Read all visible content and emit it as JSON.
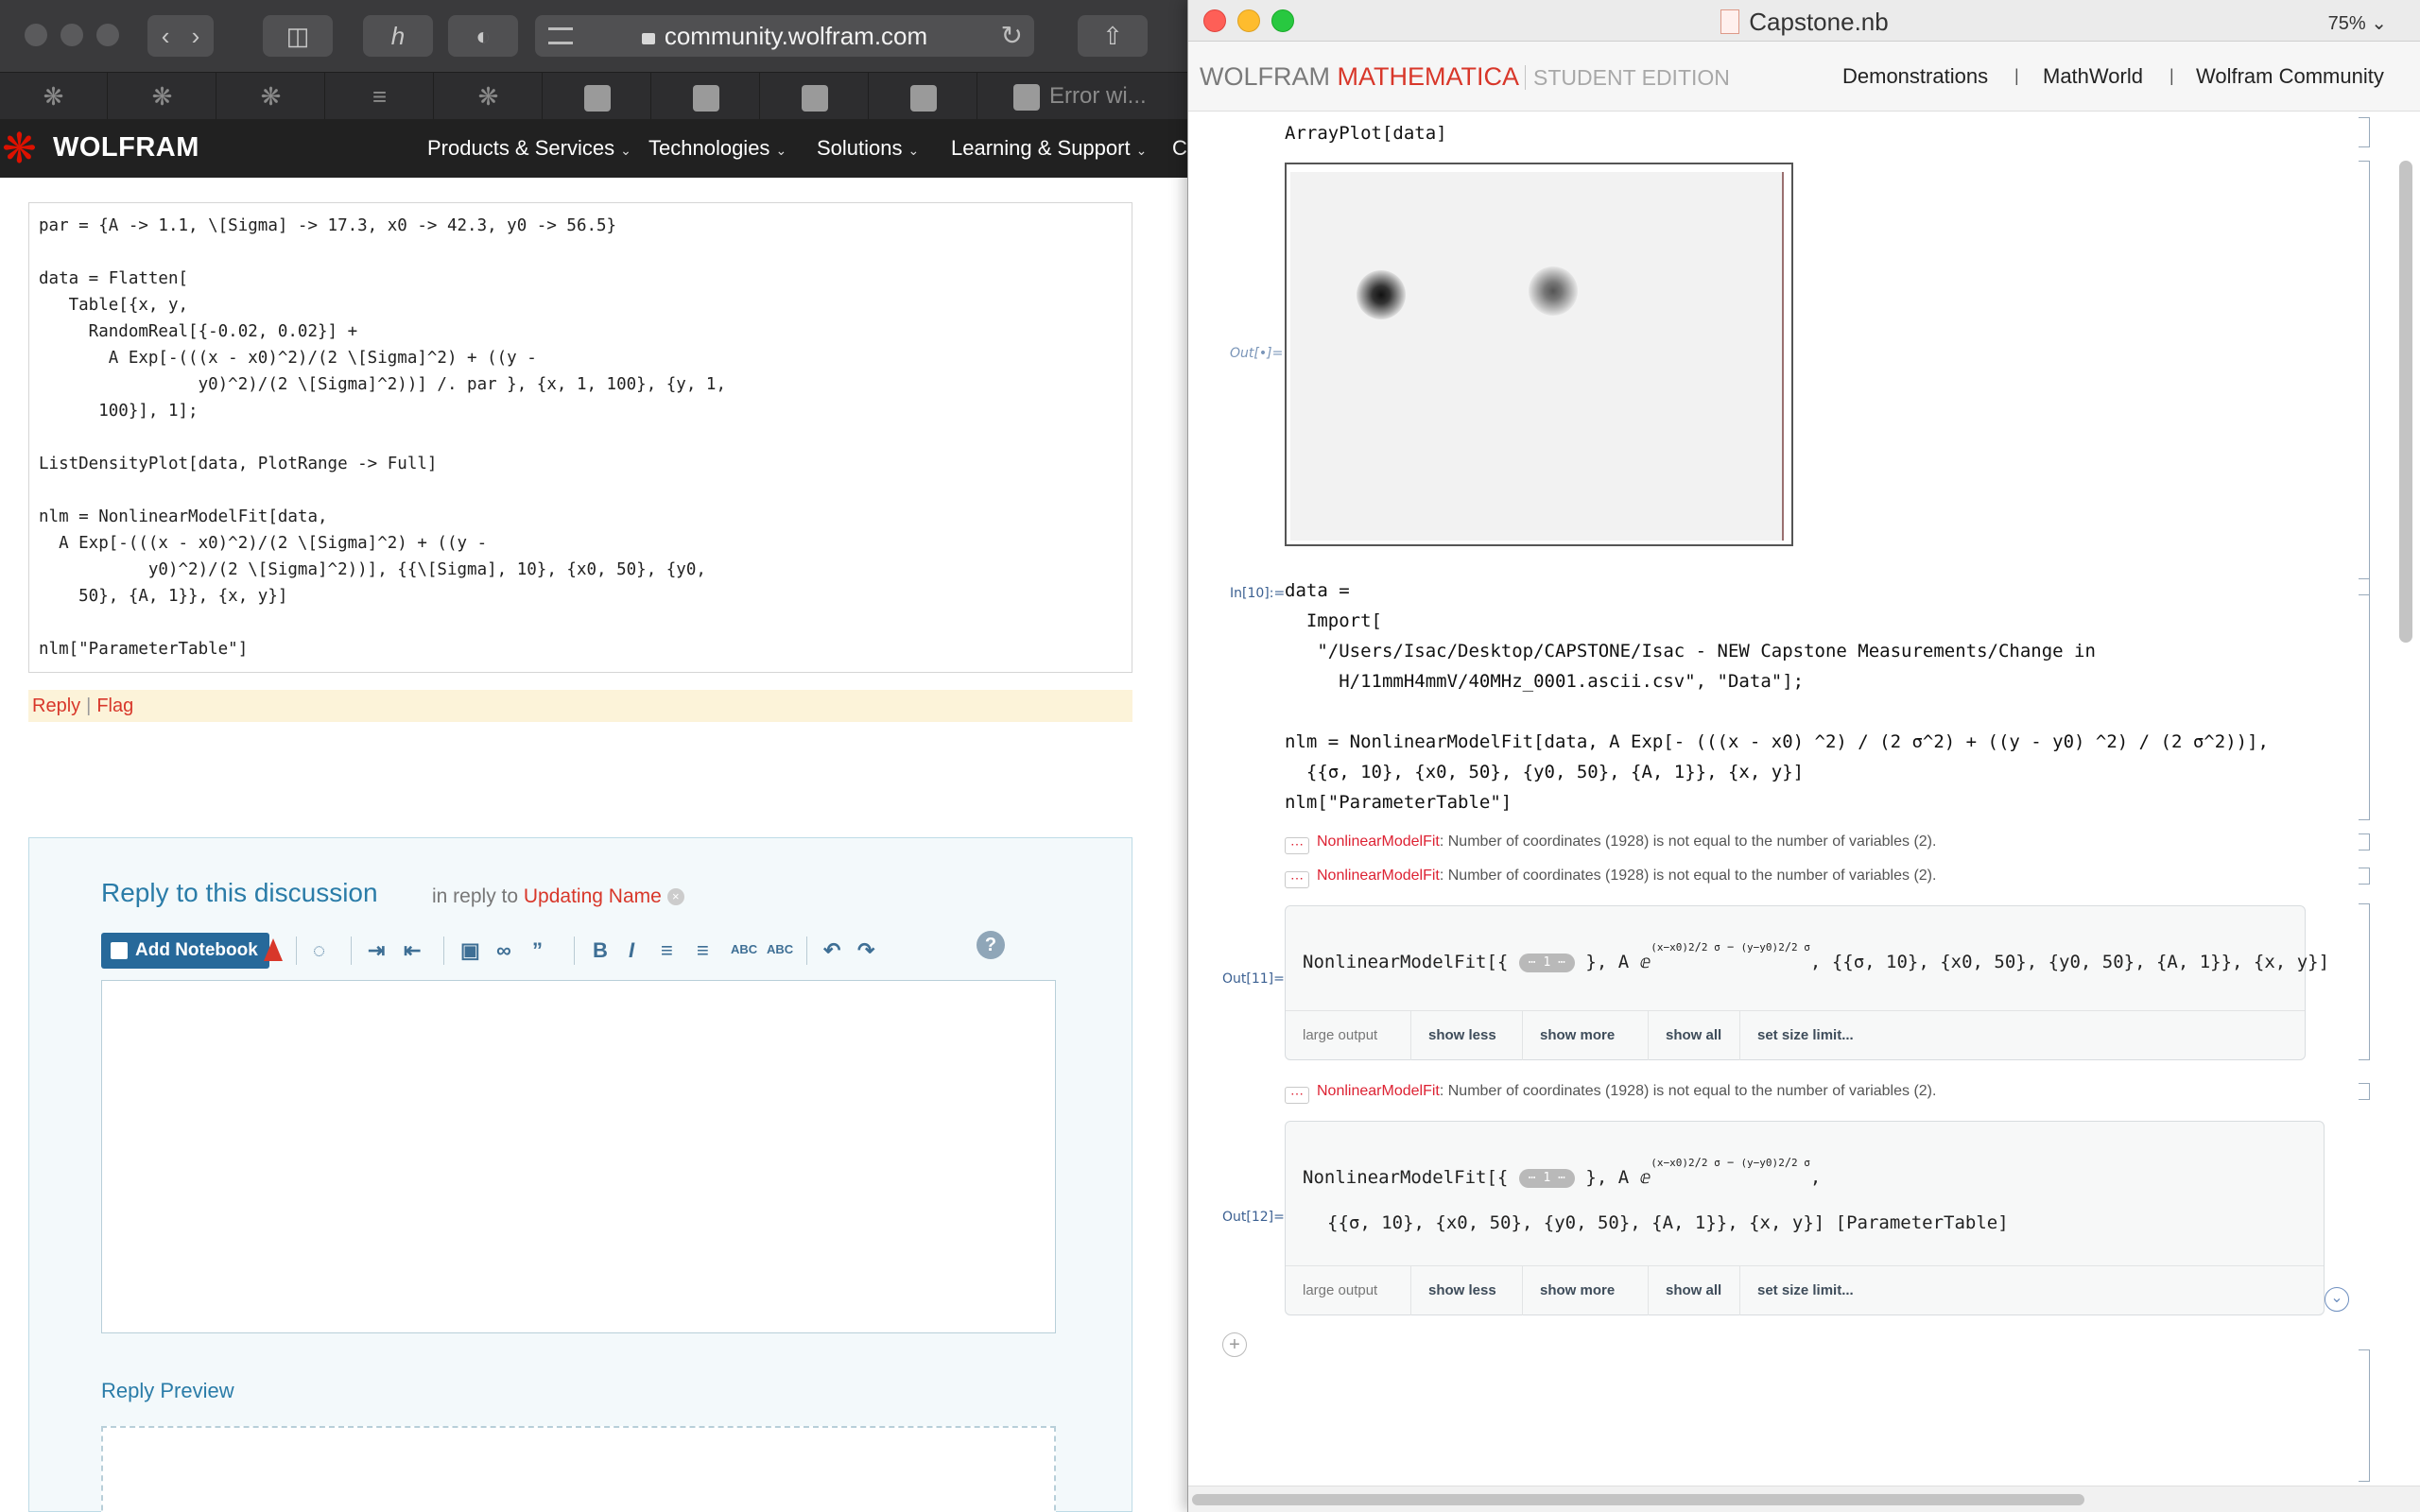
{
  "browser": {
    "url": "community.wolfram.com",
    "tab_error_label": "Error wi...",
    "logo_text": "WOLFRAM",
    "nav": [
      "Products & Services",
      "Technologies",
      "Solutions",
      "Learning & Support",
      "Co"
    ],
    "code_lines": [
      "par = {A -> 1.1, \\[Sigma] -> 17.3, x0 -> 42.3, y0 -> 56.5}",
      "",
      "data = Flatten[",
      "   Table[{x, y,",
      "     RandomReal[{-0.02, 0.02}] +",
      "       A Exp[-(((x - x0)^2)/(2 \\[Sigma]^2) + ((y -",
      "                y0)^2)/(2 \\[Sigma]^2))] /. par }, {x, 1, 100}, {y, 1,",
      "      100}], 1];",
      "",
      "ListDensityPlot[data, PlotRange -> Full]",
      "",
      "nlm = NonlinearModelFit[data,",
      "  A Exp[-(((x - x0)^2)/(2 \\[Sigma]^2) + ((y -",
      "           y0)^2)/(2 \\[Sigma]^2))], {{\\[Sigma], 10}, {x0, 50}, {y0,",
      "    50}, {A, 1}}, {x, y}]",
      "",
      "nlm[\"ParameterTable\"]"
    ],
    "reply_link": "Reply",
    "flag_link": "Flag",
    "reply_panel": {
      "title": "Reply to this discussion",
      "in_reply_prefix": "in reply to",
      "in_reply_name": "Updating Name",
      "add_notebook": "Add Notebook",
      "preview_title": "Reply Preview"
    }
  },
  "mathematica": {
    "title": "Capstone.nb",
    "zoom": "75%",
    "brand_wolfram": "WOLFRAM",
    "brand_mathematica": "MATHEMATICA",
    "brand_edition": "STUDENT EDITION",
    "banner_links": [
      "Demonstrations",
      "MathWorld",
      "Wolfram Community"
    ],
    "cell1_code": "ArrayPlot[data]",
    "out_label": "Out[•]=",
    "in10_label": "In[10]:=",
    "in10_lines": [
      "data =",
      "  Import[",
      "   \"/Users/Isac/Desktop/CAPSTONE/Isac - NEW Capstone Measurements/Change in",
      "     H/11mmH4mmV/40MHz_0001.ascii.csv\", \"Data\"];",
      "",
      "nlm = NonlinearModelFit[data, A Exp[- (((x - x0) ^2) / (2 σ^2) + ((y - y0) ^2) / (2 σ^2))],",
      "  {{σ, 10}, {x0, 50}, {y0, 50}, {A, 1}}, {x, y}]",
      "nlm[\"ParameterTable\"]"
    ],
    "message_fn": "NonlinearModelFit",
    "message_text": ": Number of coordinates (1928) is not equal to the number of variables (2).",
    "out11_label": "Out[11]=",
    "out12_label": "Out[12]=",
    "out_head": "NonlinearModelFit",
    "out_pill": "⋯ 1 ⋯",
    "out_tail": "{{σ, 10}, {x0, 50}, {y0, 50}, {A, 1}}, {x, y}",
    "out12_suffix": "[ParameterTable]",
    "exp_top1": "(x−x0)",
    "exp_bot1": "2 σ",
    "exp_top2": "(y−y0)",
    "exp_bot2": "2 σ",
    "controls": [
      "large output",
      "show less",
      "show more",
      "show all",
      "set size limit..."
    ]
  }
}
